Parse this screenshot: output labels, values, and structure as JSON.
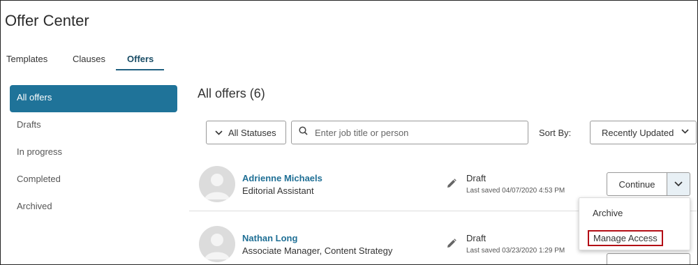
{
  "header": {
    "title": "Offer Center"
  },
  "tabs": [
    {
      "label": "Templates"
    },
    {
      "label": "Clauses"
    },
    {
      "label": "Offers"
    }
  ],
  "sidebar": {
    "items": [
      {
        "label": "All offers"
      },
      {
        "label": "Drafts"
      },
      {
        "label": "In progress"
      },
      {
        "label": "Completed"
      },
      {
        "label": "Archived"
      }
    ]
  },
  "main": {
    "title": "All offers (6)",
    "filter_label": "All Statuses",
    "search_placeholder": "Enter job title or person",
    "sort_label": "Sort By:",
    "sort_value": "Recently Updated"
  },
  "offers": [
    {
      "name": "Adrienne Michaels",
      "job": "Editorial Assistant",
      "status": "Draft",
      "saved": "Last saved 04/07/2020 4:53 PM",
      "action": "Continue"
    },
    {
      "name": "Nathan Long",
      "job": "Associate Manager, Content Strategy",
      "status": "Draft",
      "saved": "Last saved 03/23/2020 1:29 PM"
    }
  ],
  "menu": {
    "archive": "Archive",
    "manage_access": "Manage Access"
  },
  "colors": {
    "accent": "#1f7399",
    "link": "#1f6f95",
    "highlight_border": "#b30d15"
  },
  "icons": [
    "chevron-down-icon",
    "search-icon",
    "pencil-icon",
    "avatar-placeholder-icon"
  ]
}
